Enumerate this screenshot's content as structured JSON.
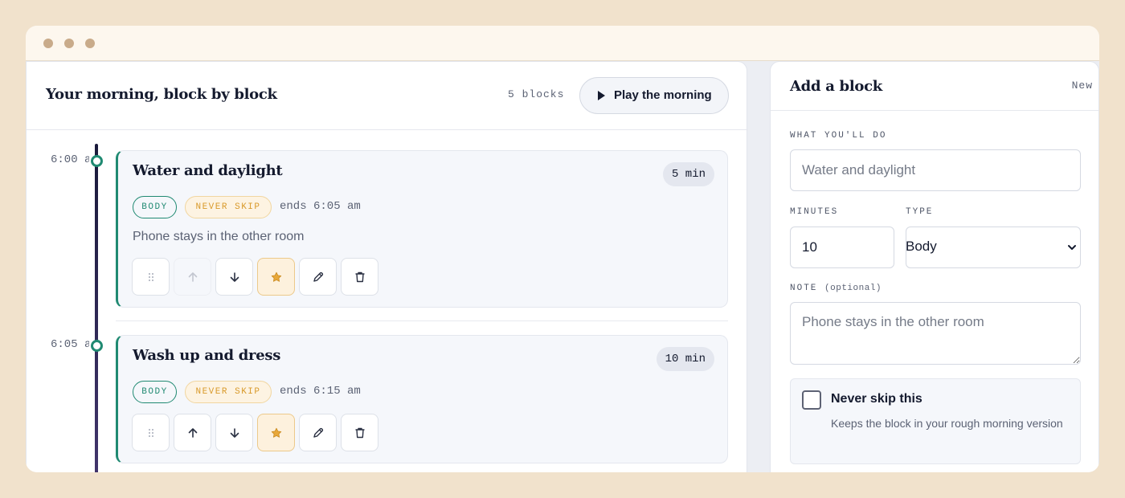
{
  "window": {},
  "timeline": {
    "title": "Your morning, block by block",
    "count_label": "5 blocks",
    "play_label": "Play the morning",
    "blocks": [
      {
        "time": "6:00 am",
        "title": "Water and daylight",
        "duration": "5 min",
        "tags": [
          "BODY",
          "NEVER SKIP"
        ],
        "ends": "ends 6:05 am",
        "note": "Phone stays in the other room",
        "move_up_enabled": false
      },
      {
        "time": "6:05 am",
        "title": "Wash up and dress",
        "duration": "10 min",
        "tags": [
          "BODY",
          "NEVER SKIP"
        ],
        "ends": "ends 6:15 am",
        "move_up_enabled": true
      }
    ]
  },
  "form": {
    "title": "Add a block",
    "badge": "New",
    "what_label": "WHAT YOU'LL DO",
    "what_placeholder": "Water and daylight",
    "minutes_label": "MINUTES",
    "minutes_value": "10",
    "type_label": "TYPE",
    "type_value": "Body",
    "note_label": "NOTE",
    "note_optional": "(optional)",
    "note_placeholder": "Phone stays in the other room",
    "never_skip_title": "Never skip this",
    "never_skip_desc": "Keeps the block in your rough morning version",
    "never_skip_checked": false
  },
  "colors": {
    "page_bg": "#f1e2cc",
    "accent_green": "#208a72",
    "accent_amber": "#d99a2b",
    "timeline_dark": "#19193a",
    "text_dark": "#141a2e"
  }
}
